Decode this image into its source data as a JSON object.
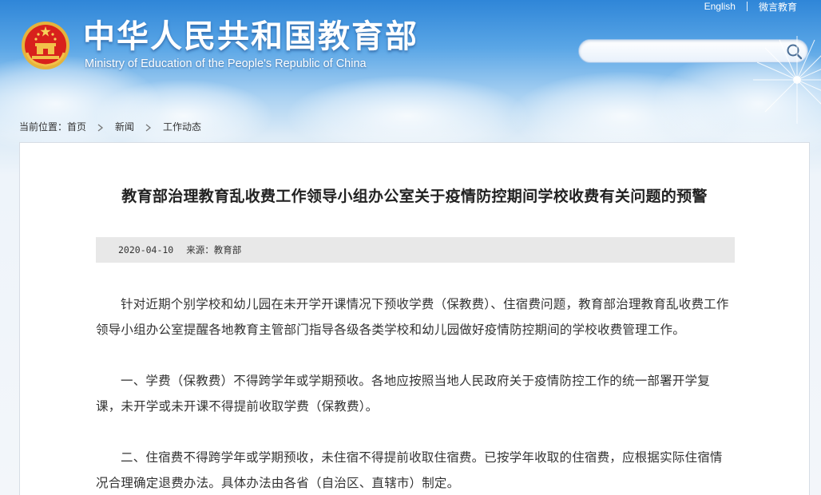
{
  "header": {
    "site_title": "中华人民共和国教育部",
    "site_subtitle": "Ministry of Education of the People's Republic of China",
    "top_links": {
      "english": "English",
      "weibo": "微言教育"
    },
    "search": {
      "value": "",
      "placeholder": ""
    }
  },
  "breadcrumb": {
    "prefix": "当前位置：",
    "items": [
      "首页",
      "新闻",
      "工作动态"
    ]
  },
  "article": {
    "title": "教育部治理教育乱收费工作领导小组办公室关于疫情防控期间学校收费有关问题的预警",
    "date": "2020-04-10",
    "source": "来源：教育部",
    "paragraphs": [
      "针对近期个别学校和幼儿园在未开学开课情况下预收学费（保教费）、住宿费问题，教育部治理教育乱收费工作领导小组办公室提醒各地教育主管部门指导各级各类学校和幼儿园做好疫情防控期间的学校收费管理工作。",
      "一、学费（保教费）不得跨学年或学期预收。各地应按照当地人民政府关于疫情防控工作的统一部署开学复课，未开学或未开课不得提前收取学费（保教费）。",
      "二、住宿费不得跨学年或学期预收，未住宿不得提前收取住宿费。已按学年收取的住宿费，应根据实际住宿情况合理确定退费办法。具体办法由各省（自治区、直辖市）制定。"
    ]
  },
  "colors": {
    "header_blue": "#2f86d8",
    "emblem_red": "#d8211c",
    "emblem_gold": "#f2c14a",
    "meta_bar_bg": "#e8e8e8"
  },
  "icons": {
    "emblem": "national-emblem-icon",
    "search": "search-icon",
    "breadcrumb_sep": "chevron-right-icon"
  }
}
